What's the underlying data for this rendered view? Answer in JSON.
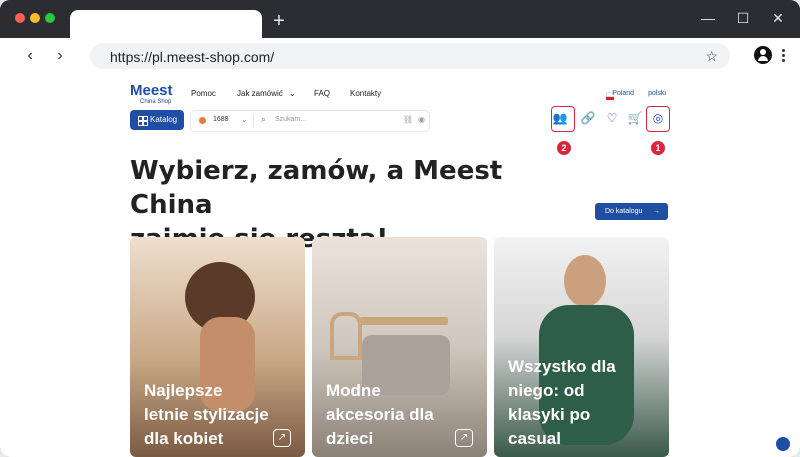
{
  "browser": {
    "url": "https://pl.meest-shop.com/",
    "new_tab_symbol": "+",
    "controls": {
      "minimize": "—",
      "maximize": "☐",
      "close": "✕"
    }
  },
  "site": {
    "logo": {
      "brand": "Meest",
      "sub": "China Shop"
    },
    "nav": [
      "Pomoc",
      "Jak zamówić",
      "FAQ",
      "Kontakty"
    ],
    "country": "Poland",
    "language": "polski"
  },
  "search": {
    "catalog_button": "Katalog",
    "price_value": "1688",
    "placeholder": "Szukam..."
  },
  "header_icons": [
    "users-icon",
    "link-icon",
    "heart-icon",
    "cart-icon",
    "profile-icon"
  ],
  "annotations": {
    "first": "1",
    "second": "2",
    "color": "#d7263d"
  },
  "hero": {
    "title_line1": "Wybierz, zamów, a Meest China",
    "title_line2": "zajmie się resztą!",
    "cta": "Do katalogu",
    "cta_arrow": "→"
  },
  "cards": [
    {
      "title": "Najlepsze letnie stylizacje dla kobiet"
    },
    {
      "title": "Modne akcesoria dla dzieci"
    },
    {
      "title": "Wszystko dla niego: od klasyki po casual"
    }
  ],
  "colors": {
    "brand": "#1f4ea3"
  }
}
